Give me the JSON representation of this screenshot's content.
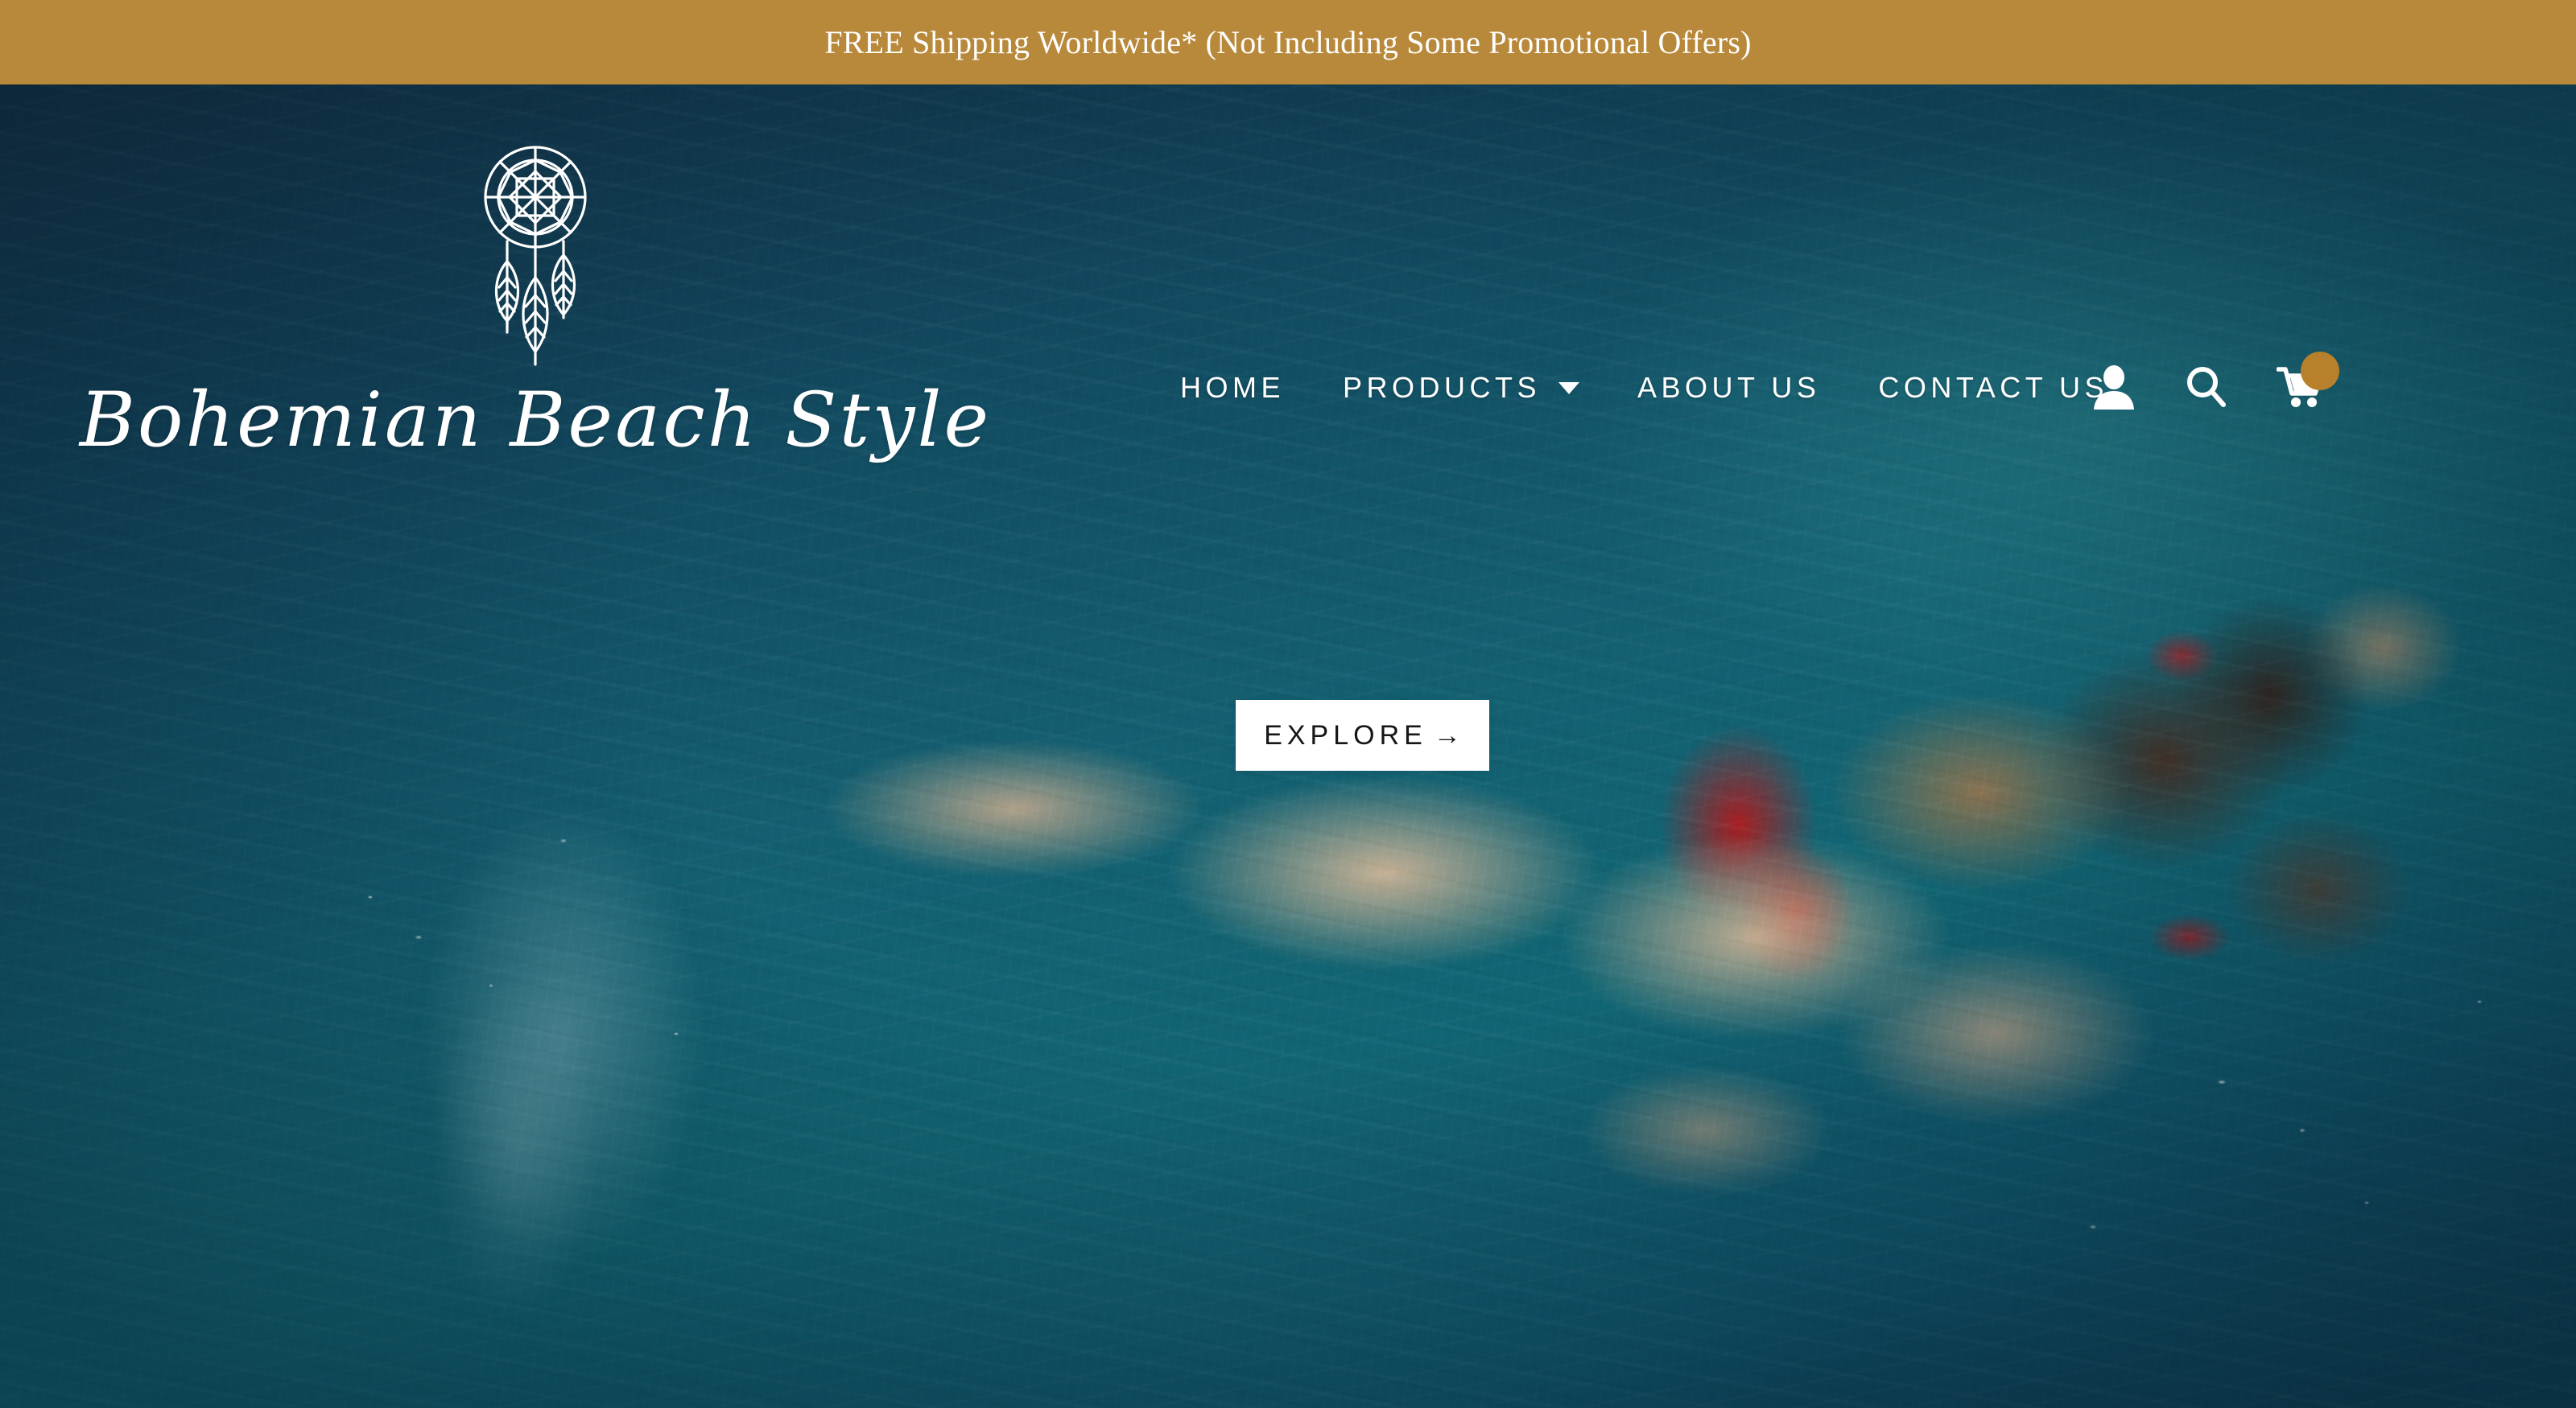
{
  "announcement": {
    "text": "FREE Shipping Worldwide* (Not Including Some Promotional Offers)",
    "background_color": "#b8893a",
    "text_color": "#ffffff"
  },
  "brand": {
    "name": "Bohemian Beach Style",
    "logo_icon": "dreamcatcher-icon"
  },
  "nav": {
    "items": [
      {
        "label": "HOME",
        "has_dropdown": false
      },
      {
        "label": "PRODUCTS",
        "has_dropdown": true
      },
      {
        "label": "ABOUT US",
        "has_dropdown": false
      },
      {
        "label": "CONTACT US",
        "has_dropdown": false
      }
    ]
  },
  "header_icons": [
    {
      "name": "account-icon",
      "label": "Account"
    },
    {
      "name": "search-icon",
      "label": "Search"
    },
    {
      "name": "cart-icon",
      "label": "Cart",
      "badge": "",
      "badge_color": "#b8802a"
    }
  ],
  "hero": {
    "cta": {
      "label": "EXPLORE",
      "arrow": "→"
    },
    "image_description": "Aerial photo of a woman in a red swimsuit swimming in turquoise ocean water"
  }
}
